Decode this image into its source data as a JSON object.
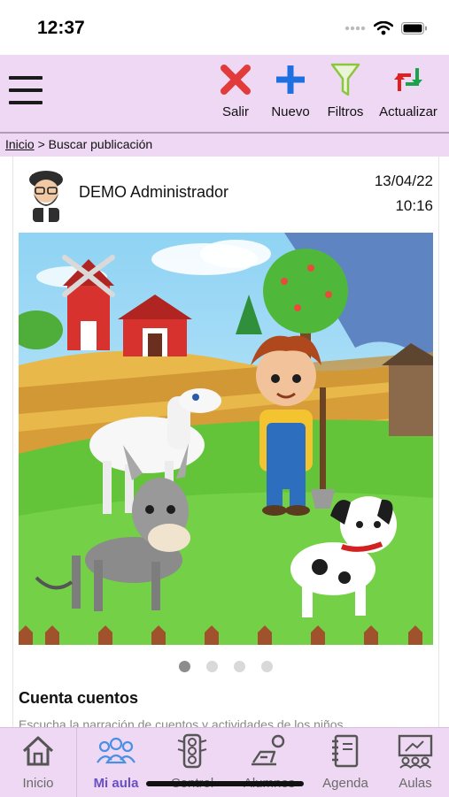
{
  "status_bar": {
    "time": "12:37"
  },
  "toolbar": {
    "buttons": [
      {
        "label": "Salir",
        "icon": "close-icon",
        "color": "#e23b3b"
      },
      {
        "label": "Nuevo",
        "icon": "plus-icon",
        "color": "#1e6fe0"
      },
      {
        "label": "Filtros",
        "icon": "filter-icon",
        "color": "#8cc63f"
      },
      {
        "label": "Actualizar",
        "icon": "refresh-icon",
        "color": "#e02020"
      }
    ]
  },
  "breadcrumb": {
    "home": "Inicio",
    "separator": " > ",
    "current": "Buscar publicación"
  },
  "post": {
    "author": "DEMO Administrador",
    "date": "13/04/22",
    "time": "10:16",
    "image": "farm-illustration",
    "carousel": {
      "pages": 4,
      "active": 1
    },
    "title": "Cuenta cuentos",
    "excerpt": "Escucha la narración de cuentos y actividades de los niños..."
  },
  "tabbar": {
    "tabs": [
      {
        "label": "Inicio",
        "icon": "home-icon",
        "active": false
      },
      {
        "label": "Mi aula",
        "icon": "group-icon",
        "active": true
      },
      {
        "label": "Control",
        "icon": "traffic-light-icon",
        "active": false
      },
      {
        "label": "Alumnos",
        "icon": "student-icon",
        "active": false
      },
      {
        "label": "Agenda",
        "icon": "notebook-icon",
        "active": false
      },
      {
        "label": "Aulas",
        "icon": "classroom-icon",
        "active": false
      }
    ]
  },
  "colors": {
    "accent_bg": "#efd8f3",
    "active_tab": "#6a4fc2"
  }
}
